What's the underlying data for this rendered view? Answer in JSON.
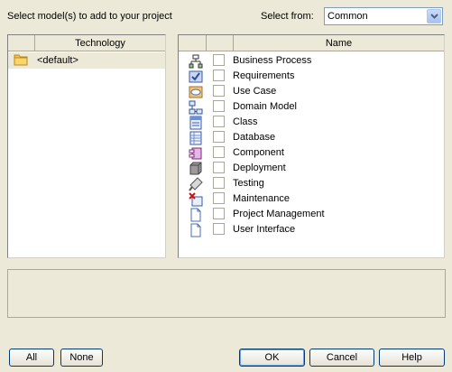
{
  "header": {
    "select_models_label": "Select model(s) to add to your project",
    "select_from_label": "Select from:",
    "select_from_value": "Common"
  },
  "technology_list": {
    "column_header": "Technology",
    "items": [
      {
        "label": "<default>",
        "icon": "folder-icon"
      }
    ]
  },
  "model_list": {
    "column_header": "Name",
    "items": [
      {
        "label": "Business Process",
        "icon": "business-process-icon",
        "checked": false
      },
      {
        "label": "Requirements",
        "icon": "requirements-icon",
        "checked": false
      },
      {
        "label": "Use Case",
        "icon": "use-case-icon",
        "checked": false
      },
      {
        "label": "Domain Model",
        "icon": "domain-model-icon",
        "checked": false
      },
      {
        "label": "Class",
        "icon": "class-icon",
        "checked": false
      },
      {
        "label": "Database",
        "icon": "database-icon",
        "checked": false
      },
      {
        "label": "Component",
        "icon": "component-icon",
        "checked": false
      },
      {
        "label": "Deployment",
        "icon": "deployment-icon",
        "checked": false
      },
      {
        "label": "Testing",
        "icon": "testing-icon",
        "checked": false
      },
      {
        "label": "Maintenance",
        "icon": "maintenance-icon",
        "checked": false
      },
      {
        "label": "Project Management",
        "icon": "project-management-icon",
        "checked": false
      },
      {
        "label": "User Interface",
        "icon": "user-interface-icon",
        "checked": false
      }
    ]
  },
  "description_box": {
    "text": ""
  },
  "buttons": {
    "all": "All",
    "none": "None",
    "ok": "OK",
    "cancel": "Cancel",
    "help": "Help"
  },
  "colors": {
    "window_bg": "#ece9d8",
    "selection_bg": "#ece9d8",
    "button_border": "#003c74"
  }
}
